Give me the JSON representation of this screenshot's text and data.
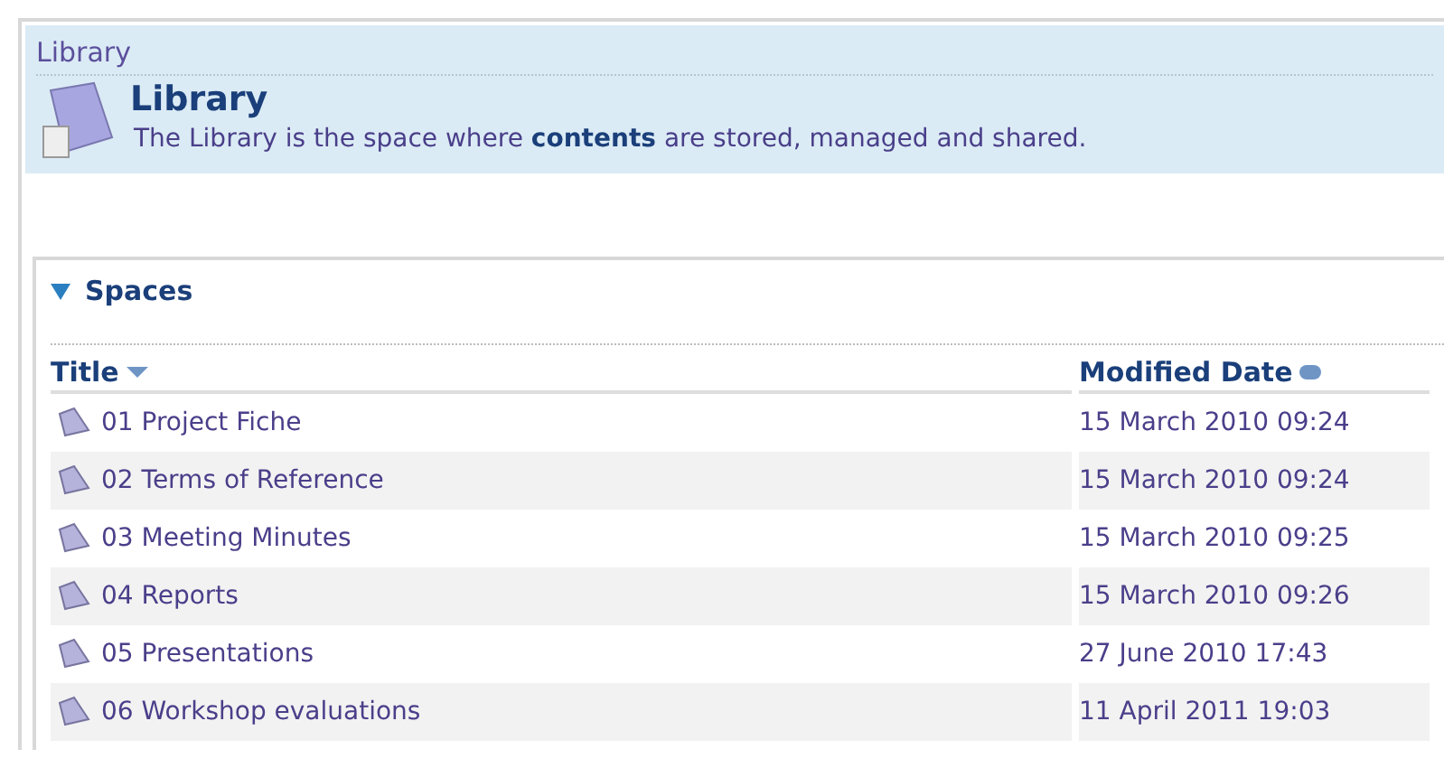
{
  "breadcrumb": "Library",
  "header": {
    "title": "Library",
    "description": "The Library is the space where **contents** are stored, managed and shared."
  },
  "section": {
    "title": "Spaces",
    "expanded": true
  },
  "table": {
    "columns": [
      {
        "label": "Title",
        "sorted": true
      },
      {
        "label": "Modified Date",
        "sorted": false
      }
    ],
    "rows": [
      {
        "title": "01 Project Fiche",
        "date": "15 March 2010 09:24"
      },
      {
        "title": "02 Terms of Reference",
        "date": "15 March 2010 09:24"
      },
      {
        "title": "03 Meeting Minutes",
        "date": "15 March 2010 09:25"
      },
      {
        "title": "04 Reports",
        "date": "15 March 2010 09:26"
      },
      {
        "title": "05 Presentations",
        "date": "27 June 2010 17:43"
      },
      {
        "title": "06 Workshop evaluations",
        "date": "11 April 2011 19:03"
      }
    ]
  }
}
